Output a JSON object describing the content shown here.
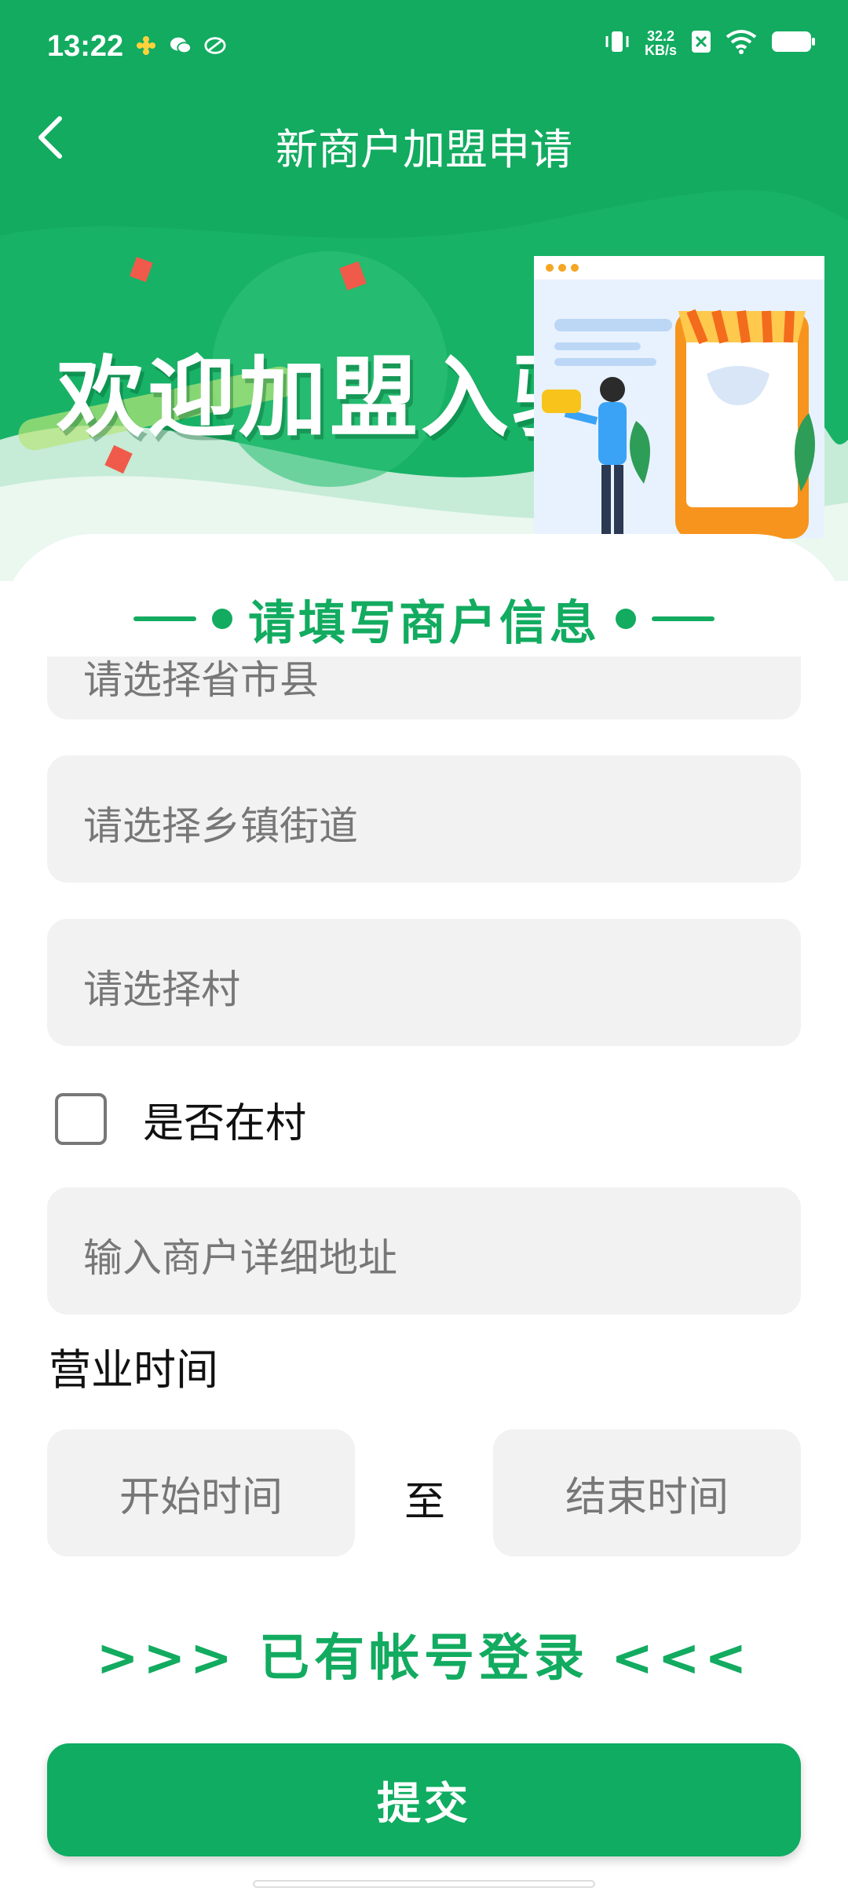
{
  "status_bar": {
    "time": "13:22",
    "net_speed_value": "32.2",
    "net_speed_unit": "KB/s"
  },
  "header": {
    "title": "新商户加盟申请"
  },
  "banner": {
    "headline": "欢迎加盟入驻"
  },
  "form": {
    "section_title": "请填写商户信息",
    "region_placeholder": "请选择省市县",
    "town_placeholder": "请选择乡镇街道",
    "village_placeholder": "请选择村",
    "in_village_label": "是否在村",
    "in_village_checked": false,
    "address_placeholder": "输入商户详细地址",
    "business_hours_label": "营业时间",
    "start_time_placeholder": "开始时间",
    "to_label": "至",
    "end_time_placeholder": "结束时间"
  },
  "login_link": ">>>  已有帐号登录  <<<",
  "submit_label": "提交",
  "colors": {
    "brand_green": "#12ab60",
    "field_bg": "#f2f2f2",
    "placeholder": "#777777"
  }
}
